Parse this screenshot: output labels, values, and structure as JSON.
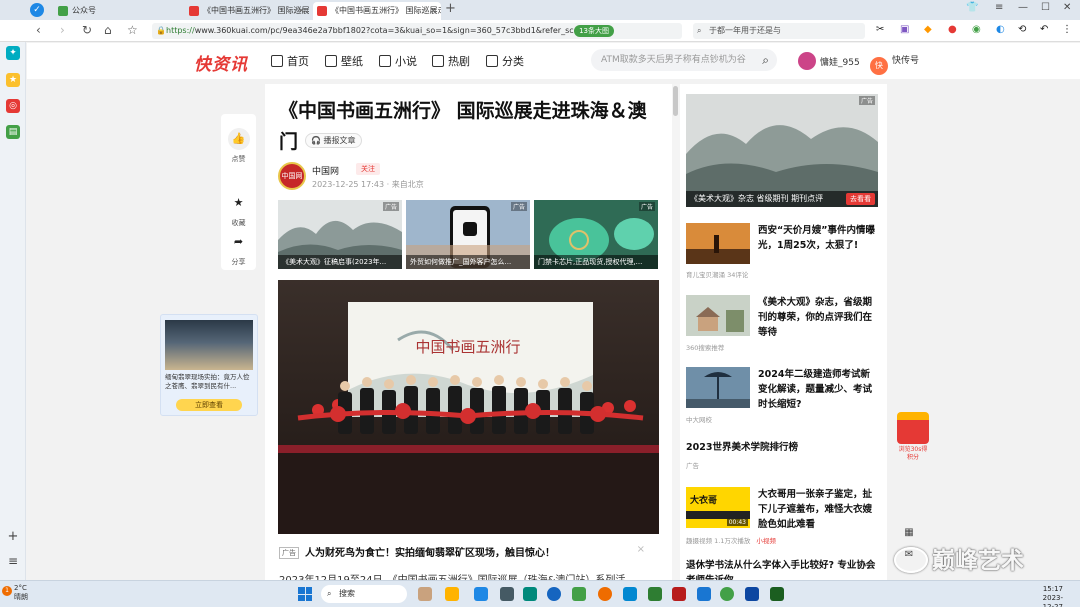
{
  "browser": {
    "tabs": [
      {
        "label": "公众号"
      },
      {
        "label": "《中国书画五洲行》 国际巡展走进"
      },
      {
        "label": "《中国书画五洲行》 国际巡展走进"
      }
    ],
    "new_tab": "+",
    "url": {
      "scheme": "https://",
      "text": "www.360kuai.com/pc/9ea346e2a7bbf1802?cota=3&kuai_so=1&sign=360_57c3bbd1&refer_scene=",
      "pill": "13条大图"
    },
    "search_text": "于都一年用于还是与"
  },
  "site": {
    "brand": "快资讯",
    "nav": [
      "首页",
      "壁纸",
      "小说",
      "热剧",
      "分类"
    ],
    "search_placeholder": "ATM取款多天后男子称有点钞机为谷",
    "user_name": "慵娃_955",
    "kuai_label": "快传号"
  },
  "actions": {
    "like": "点赞",
    "collect": "收藏",
    "share": "分享"
  },
  "left_ad": {
    "text": "缅甸翡翠现场实拍：竟万人俭之苍鹰、翡翠到民有什...",
    "button": "立即查看"
  },
  "article": {
    "title": "《中国书画五洲行》 国际巡展走进珠海＆澳门",
    "listen": "播报文章",
    "author": {
      "name": "中国网",
      "follow": "关注",
      "meta": "2023-12-25 17:43 · 来自北京",
      "avatar_text": "中国网"
    },
    "thumbs": [
      {
        "caption": "《美术大观》征稿启事(2023年...",
        "tag": "广告"
      },
      {
        "caption": "外贸如何做推广_国外客户怎么...",
        "tag": "广告"
      },
      {
        "caption": "门禁卡芯片,正品现货,授权代理,...",
        "tag": "广告"
      }
    ],
    "main_image_banner": "中国书画五洲行",
    "ad_tag": "广告",
    "ad_headline": "人为财死鸟为食亡！实拍缅甸翡翠矿区现场，触目惊心！",
    "body_first_line": "2023年12月19至24日，《中国书画五洲行》国际巡展（珠海&澳门站）系列活"
  },
  "right": {
    "banner": {
      "caption": "《美术大观》杂志 省级期刊 期刊点评",
      "button": "去看看",
      "tag": "广告"
    },
    "items": [
      {
        "title": "西安“天价月嫂”事件内情曝光，1周25次，太狠了!",
        "source": "育儿宝贝潮涌",
        "extra": "34评论"
      },
      {
        "title": "《美术大观》杂志，省级期刊的尊荣，你的点评我们在等待",
        "source": "360搜索推荐",
        "extra": ""
      },
      {
        "title": "2024年二级建造师考试新变化解读，题量减少、考试时长缩短?",
        "source": "中大网校",
        "extra": ""
      },
      {
        "title": "2023世界美术学院排行榜",
        "source": "广告",
        "extra": ""
      },
      {
        "title": "大衣哥用一张亲子鉴定，扯下儿子遮羞布，难怪大衣嫂脸色如此难看",
        "source": "趣摄视频",
        "extra": "1.1万次播放",
        "badge": "小视频",
        "thumb_text": "大衣哥",
        "duration": "00:43"
      },
      {
        "title": "退休学书法从什么字体入手比较好? 专业协会老师告诉你",
        "source": "",
        "extra": ""
      }
    ]
  },
  "floating": {
    "redpack_label": "浏览30s得积分"
  },
  "watermark": "巅峰艺术",
  "taskbar": {
    "weather_temp": "2°C",
    "weather_desc": "晴朗",
    "badge": "1",
    "search": "搜索",
    "time": "15:17",
    "date": "2023-12-27"
  },
  "colors": {
    "brand_red": "#e53935",
    "link_blue": "#1e88e5",
    "green": "#43a047"
  }
}
